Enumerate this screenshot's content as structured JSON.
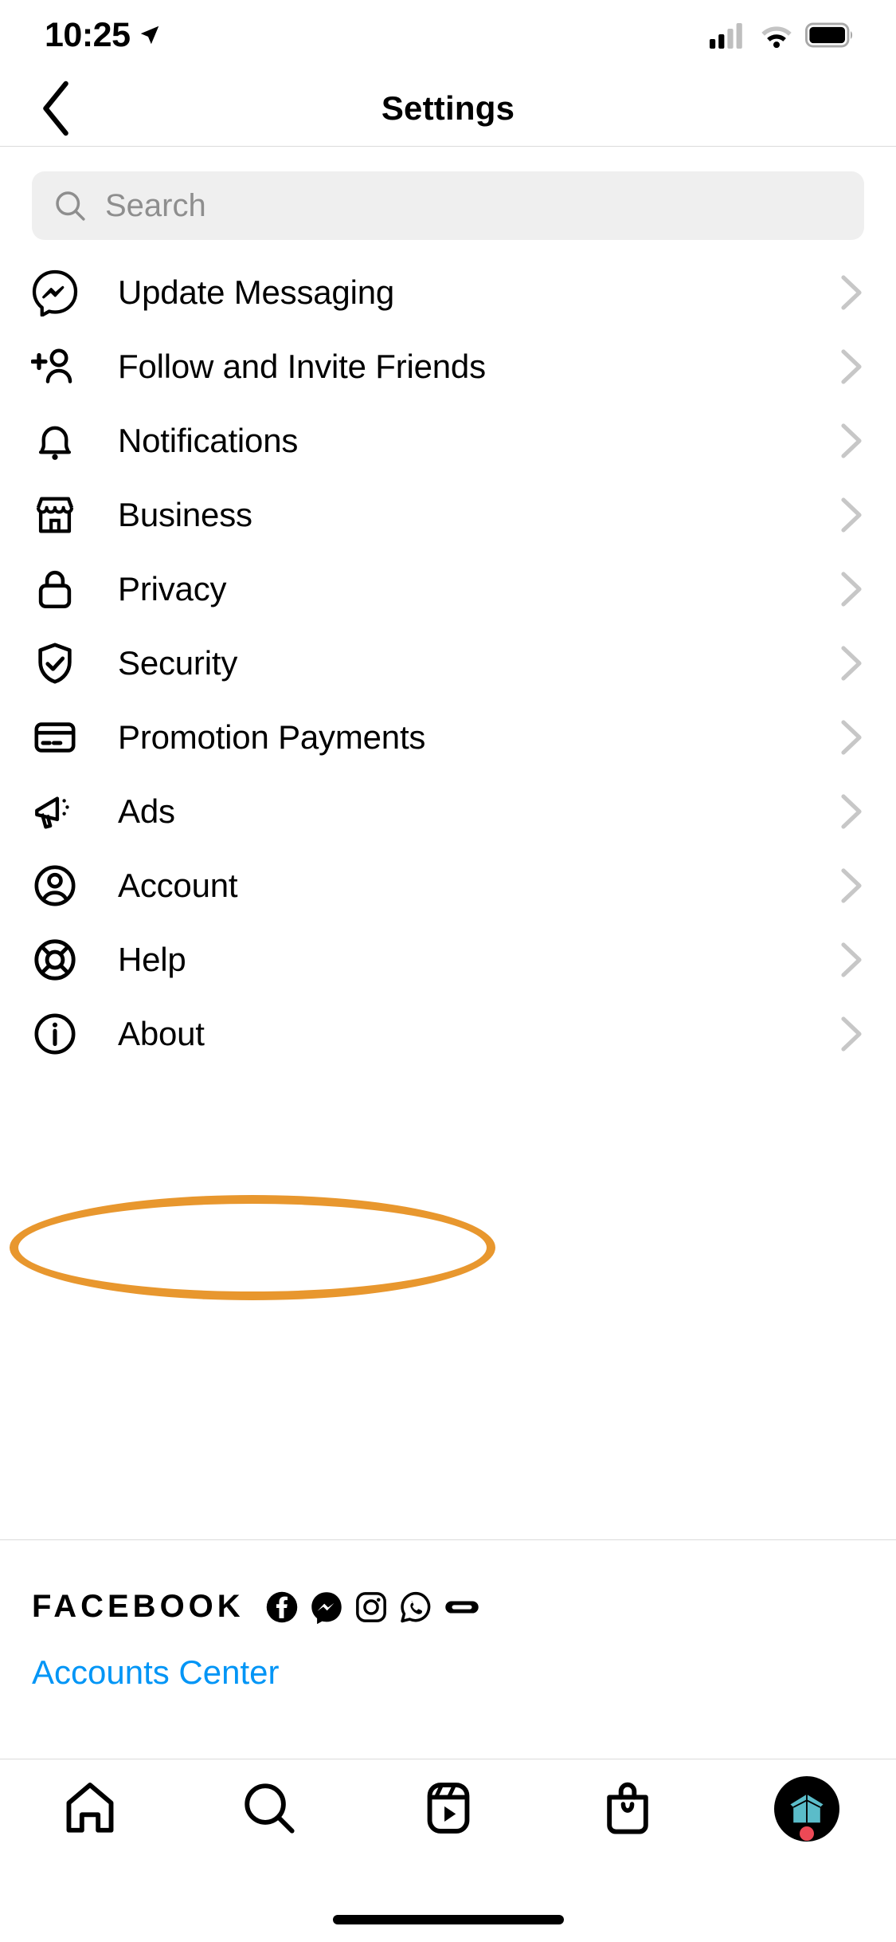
{
  "status_bar": {
    "time": "10:25",
    "location_icon": "location-arrow-icon",
    "signal_icon": "cellular-signal-icon",
    "wifi_icon": "wifi-icon",
    "battery_icon": "battery-icon"
  },
  "header": {
    "title": "Settings",
    "back_icon": "chevron-left-icon"
  },
  "search": {
    "placeholder": "Search",
    "value": "",
    "icon": "search-icon"
  },
  "settings_list": [
    {
      "label": "Update Messaging",
      "icon": "messenger-icon",
      "chevron": "chevron-right-icon"
    },
    {
      "label": "Follow and Invite Friends",
      "icon": "person-add-icon",
      "chevron": "chevron-right-icon"
    },
    {
      "label": "Notifications",
      "icon": "bell-icon",
      "chevron": "chevron-right-icon"
    },
    {
      "label": "Business",
      "icon": "storefront-icon",
      "chevron": "chevron-right-icon"
    },
    {
      "label": "Privacy",
      "icon": "lock-icon",
      "chevron": "chevron-right-icon"
    },
    {
      "label": "Security",
      "icon": "shield-check-icon",
      "chevron": "chevron-right-icon"
    },
    {
      "label": "Promotion Payments",
      "icon": "credit-card-icon",
      "chevron": "chevron-right-icon"
    },
    {
      "label": "Ads",
      "icon": "megaphone-icon",
      "chevron": "chevron-right-icon"
    },
    {
      "label": "Account",
      "icon": "account-circle-icon",
      "chevron": "chevron-right-icon"
    },
    {
      "label": "Help",
      "icon": "life-ring-icon",
      "chevron": "chevron-right-icon"
    },
    {
      "label": "About",
      "icon": "info-circle-icon",
      "chevron": "chevron-right-icon"
    }
  ],
  "facebook_section": {
    "wordmark": "FACEBOOK",
    "brand_icons": [
      "facebook-icon",
      "messenger-icon",
      "instagram-icon",
      "whatsapp-icon",
      "oculus-icon"
    ],
    "accounts_center_label": "Accounts Center"
  },
  "highlight": {
    "target_label": "Account",
    "color": "#e8972e",
    "shape": "ellipse"
  },
  "tab_bar": {
    "tabs": [
      {
        "name": "home",
        "icon": "home-icon",
        "active": false
      },
      {
        "name": "search",
        "icon": "search-icon",
        "active": false
      },
      {
        "name": "reels",
        "icon": "reels-icon",
        "active": false
      },
      {
        "name": "shop",
        "icon": "shop-bag-icon",
        "active": false
      },
      {
        "name": "profile",
        "icon": "avatar-icon",
        "active": true,
        "badge": true
      }
    ],
    "avatar_color": "#5bbcc9"
  },
  "colors": {
    "accent_blue": "#0095f6",
    "highlight_orange": "#e8972e",
    "badge_red": "#ed4956",
    "divider": "#dbdbdb",
    "search_bg": "#efefef",
    "placeholder": "#8e8e8e",
    "chevron_gray": "#c7c7c7"
  }
}
